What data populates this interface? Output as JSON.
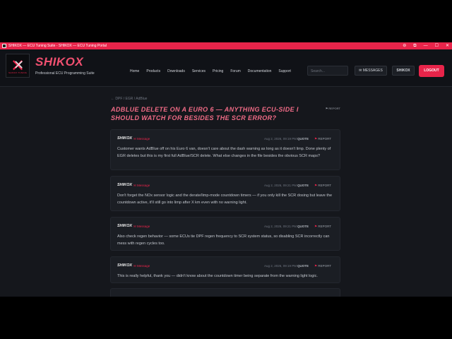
{
  "window": {
    "title": "SHIKOX — ECU Tuning Suite - SHIKOX — ECU Tuning Portal",
    "controls": [
      "⊖",
      "⧉",
      "—",
      "☐",
      "✕"
    ]
  },
  "brand": {
    "logo_text": "SHIKOX TUNING",
    "name": "SHIKOX",
    "subtitle": "Professional ECU Programming Suite"
  },
  "nav": {
    "items": [
      "Home",
      "Products",
      "Downloads",
      "Services",
      "Pricing",
      "Forum",
      "Documentation",
      "Support"
    ]
  },
  "header": {
    "search_placeholder": "Search...",
    "messages_label": "✉ MESSAGES",
    "user_label": "SHIKOX",
    "logout_label": "LOGOUT"
  },
  "thread": {
    "breadcrumb": "← DPF / EGR / AdBlue",
    "title": "AdBlue delete on a Euro 6 — anything ECU-side I should watch for besides the SCR error?",
    "report_label": "⚑ REPORT"
  },
  "posts": [
    {
      "user": "SHIKOX",
      "message": "✉ Message",
      "date": "Aug 2, 2026, 09:19 PM",
      "quote": "QUOTE",
      "report": "REPORT",
      "body": "Customer wants AdBlue off on his Euro 6 van, doesn't care about the dash warning as long as it doesn't limp. Done plenty of EGR deletes but this is my first full AdBlue/SCR delete. What else changes in the file besides the obvious SCR maps?"
    },
    {
      "user": "SHIKOX",
      "message": "✉ Message",
      "date": "Aug 2, 2026, 09:21 PM",
      "quote": "QUOTE",
      "report": "REPORT",
      "body": "Don't forget the NOx sensor logic and the derate/limp-mode countdown timers — if you only kill the SCR dosing but leave the countdown active, it'll still go into limp after X km even with no warning light."
    },
    {
      "user": "SHIKOX",
      "message": "✉ Message",
      "date": "Aug 2, 2026, 09:21 PM",
      "quote": "QUOTE",
      "report": "REPORT",
      "body": "Also check regen behavior — some ECUs tie DPF regen frequency to SCR system status, so disabling SCR incorrectly can mess with regen cycles too."
    },
    {
      "user": "SHIKOX",
      "message": "✉ Message",
      "date": "Aug 2, 2026, 09:19 PM",
      "quote": "QUOTE",
      "report": "REPORT",
      "body": "This is really helpful, thank you — didn't know about the countdown timer being separate from the warning light logic."
    }
  ]
}
